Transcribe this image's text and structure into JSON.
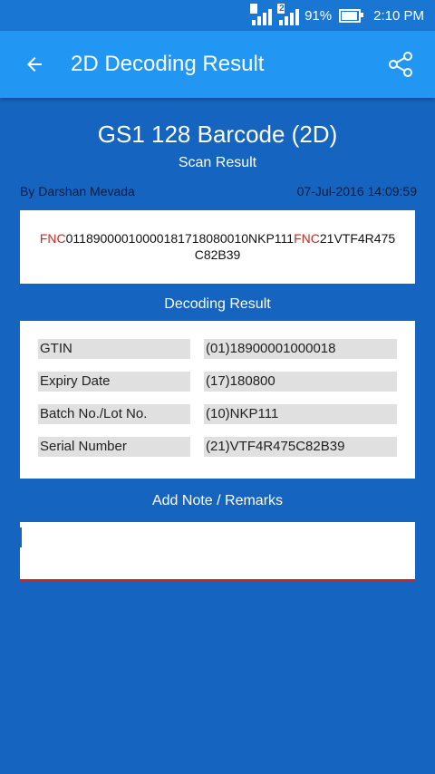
{
  "status_bar": {
    "sim1": "3",
    "sim2": "2",
    "battery": "91%",
    "time": "2:10 PM"
  },
  "app_bar": {
    "title": "2D Decoding Result",
    "back_icon": "arrow-left-icon",
    "share_icon": "share-icon"
  },
  "header": {
    "title": "GS1 128 Barcode (2D)",
    "subtitle": "Scan Result",
    "author": "By Darshan Mevada",
    "timestamp": "07-Jul-2016 14:09:59"
  },
  "raw_scan": {
    "parts": [
      {
        "text": "FNC",
        "highlight": true
      },
      {
        "text": "0118900001000018171808001 0NKP111",
        "highlight": false
      },
      {
        "text": "FNC",
        "highlight": true
      },
      {
        "text": "21VTF4R475C82B39",
        "highlight": false
      }
    ]
  },
  "decoding": {
    "label": "Decoding Result",
    "rows": [
      {
        "key": "GTIN",
        "value": "(01)18900001000018"
      },
      {
        "key": "Expiry Date",
        "value": "(17)180800"
      },
      {
        "key": "Batch No./Lot No.",
        "value": "(10)NKP111"
      },
      {
        "key": "Serial Number",
        "value": "(21)VTF4R475C82B39"
      }
    ]
  },
  "note": {
    "label": "Add Note / Remarks",
    "value": "",
    "placeholder": ""
  },
  "colors": {
    "background": "#1565c0",
    "app_bar": "#2196f3",
    "status_bar": "#1976d2",
    "fnc_highlight": "#c62828",
    "cell_bg": "#e0e0e0"
  }
}
